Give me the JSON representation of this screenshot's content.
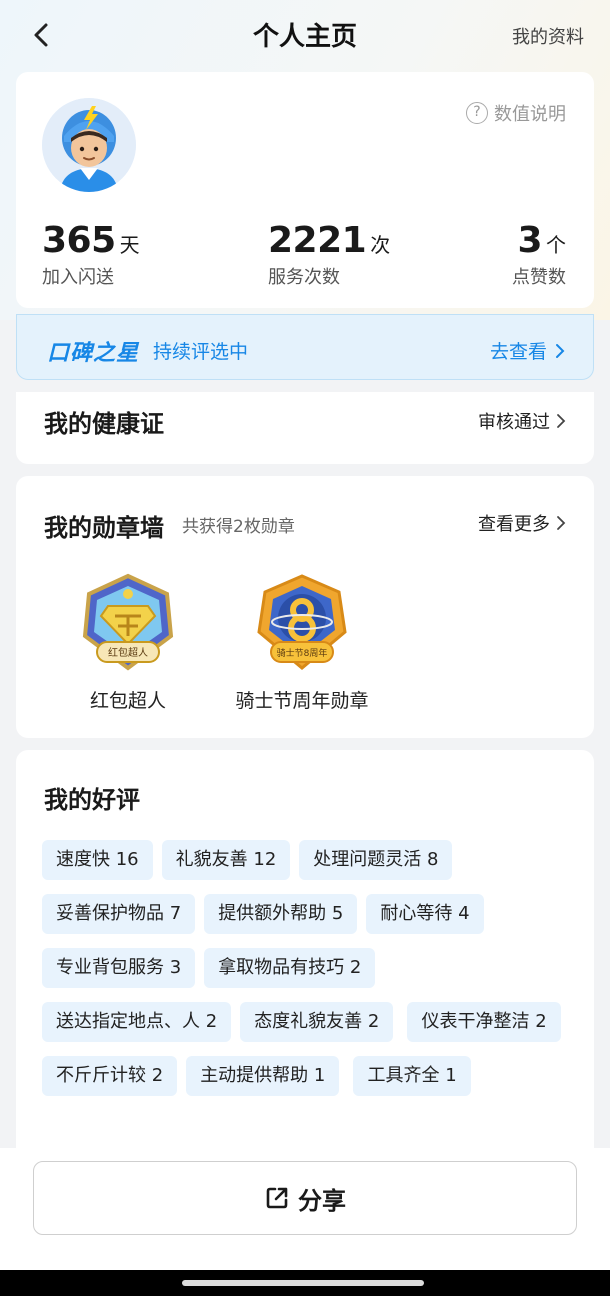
{
  "header": {
    "title": "个人主页",
    "right_link": "我的资料"
  },
  "stats_card": {
    "help_label": "数值说明",
    "stats": [
      {
        "value": "365",
        "unit": "天",
        "label": "加入闪送"
      },
      {
        "value": "2221",
        "unit": "次",
        "label": "服务次数"
      },
      {
        "value": "3",
        "unit": "个",
        "label": "点赞数"
      }
    ]
  },
  "reputation": {
    "title": "口碑之星",
    "status": "持续评选中",
    "link": "去查看"
  },
  "health": {
    "title": "我的健康证",
    "status": "审核通过"
  },
  "medals": {
    "title": "我的勋章墙",
    "count_text": "共获得2枚勋章",
    "more": "查看更多",
    "items": [
      {
        "name": "红包超人",
        "badge_text": "红包超人"
      },
      {
        "name": "骑士节周年勋章",
        "badge_text": "骑士节8周年"
      }
    ]
  },
  "reviews": {
    "title": "我的好评",
    "tags": [
      "速度快 16",
      "礼貌友善 12",
      "处理问题灵活 8",
      "妥善保护物品 7",
      "提供额外帮助 5",
      "耐心等待 4",
      "专业背包服务 3",
      "拿取物品有技巧 2",
      "送达指定地点、人 2",
      "态度礼貌友善 2",
      "仪表干净整洁 2",
      "不斤斤计较 2",
      "主动提供帮助 1",
      "工具齐全 1"
    ]
  },
  "share": {
    "label": "分享"
  },
  "colors": {
    "accent": "#1787e6",
    "tag_bg": "#e8f3fd"
  }
}
